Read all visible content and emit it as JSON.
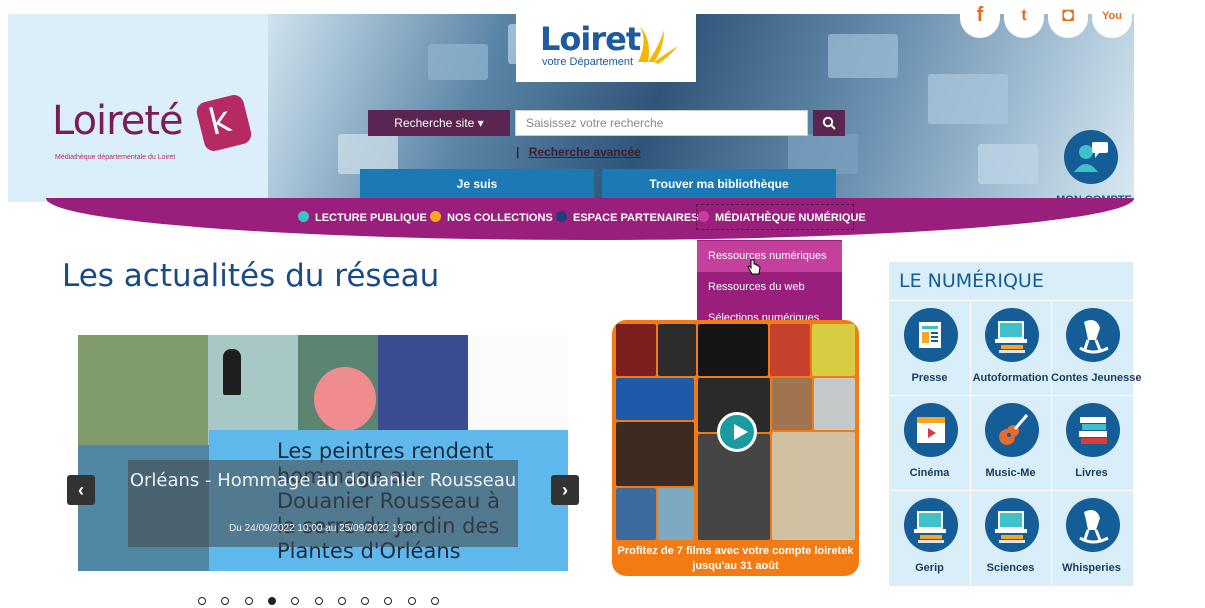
{
  "header": {
    "loiret_brand": "Loiret",
    "loiret_sub": "votre Département",
    "loiretek_brand": "Loireté",
    "loiretek_k": "k",
    "loiretek_tagline": "Médiathèque départementale du Loiret",
    "social": [
      {
        "icon": "facebook-icon",
        "glyph": "f"
      },
      {
        "icon": "twitter-icon",
        "glyph": "t"
      },
      {
        "icon": "instagram-icon",
        "glyph": "◘"
      },
      {
        "icon": "youtube-icon",
        "glyph": "You"
      }
    ],
    "search_select": "Recherche site ▾",
    "search_placeholder": "Saisissez votre recherche",
    "advanced_sep": "|",
    "advanced_search": "Recherche avancée",
    "btn_je_suis": "Je suis",
    "btn_trouver": "Trouver ma bibliothèque",
    "account_label": "MON COMPTE"
  },
  "nav": [
    {
      "label": "LECTURE PUBLIQUE",
      "color": "#3fc1c9"
    },
    {
      "label": "NOS COLLECTIONS",
      "color": "#f5a623"
    },
    {
      "label": "ESPACE PARTENAIRES",
      "color": "#1e3f7a"
    },
    {
      "label": "MÉDIATHÈQUE NUMÉRIQUE",
      "color": "#c73ca0"
    }
  ],
  "dropdown": [
    "Ressources numériques",
    "Ressources du web",
    "Sélections numériques"
  ],
  "page_title": "Les actualités du réseau",
  "slide": {
    "artwork_title": "Les peintres rendent hommage au Douanier Rousseau à la serre du Jardin des Plantes d'Orléans",
    "caption": "Orléans - Hommage au douanier Rousseau",
    "dates": "Du 24/09/2022 10:00 au 25/09/2022 19:00",
    "prev": "‹",
    "next": "›",
    "dot_count": 11,
    "active_dot": 3
  },
  "promo": {
    "caption_line1": "Profitez de 7 films avec votre compte loiretek",
    "caption_line2": "jusqu'au 31 août"
  },
  "numerique": {
    "title": "LE NUMÉRIQUE",
    "items": [
      {
        "label": "Presse",
        "icon": "newspaper-icon"
      },
      {
        "label": "Autoformation",
        "icon": "laptop-books-icon"
      },
      {
        "label": "Contes Jeunesse",
        "icon": "rocking-horse-icon"
      },
      {
        "label": "Cinéma",
        "icon": "clapperboard-icon"
      },
      {
        "label": "Music-Me",
        "icon": "guitar-icon"
      },
      {
        "label": "Livres",
        "icon": "books-icon"
      },
      {
        "label": "Gerip",
        "icon": "laptop-books-icon"
      },
      {
        "label": "Sciences",
        "icon": "laptop-books-icon"
      },
      {
        "label": "Whisperies",
        "icon": "rocking-horse-icon"
      }
    ]
  }
}
